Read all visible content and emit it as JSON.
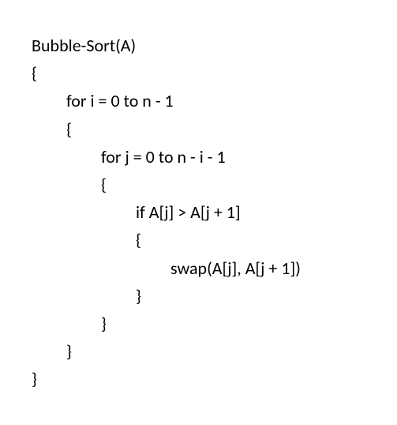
{
  "pseudocode": {
    "lines": [
      {
        "indent": 0,
        "text": "Bubble-Sort(A)"
      },
      {
        "indent": 0,
        "text": "{"
      },
      {
        "indent": 1,
        "text": "for i = 0 to n - 1"
      },
      {
        "indent": 1,
        "text": "{"
      },
      {
        "indent": 2,
        "text": "for j = 0 to n - i - 1"
      },
      {
        "indent": 2,
        "text": "{"
      },
      {
        "indent": 3,
        "text": "if A[j] > A[j + 1]"
      },
      {
        "indent": 3,
        "text": "{"
      },
      {
        "indent": 4,
        "text": "swap(A[j], A[j + 1])"
      },
      {
        "indent": 3,
        "text": "}"
      },
      {
        "indent": 2,
        "text": "}"
      },
      {
        "indent": 1,
        "text": "}"
      },
      {
        "indent": 0,
        "text": "}"
      }
    ]
  }
}
